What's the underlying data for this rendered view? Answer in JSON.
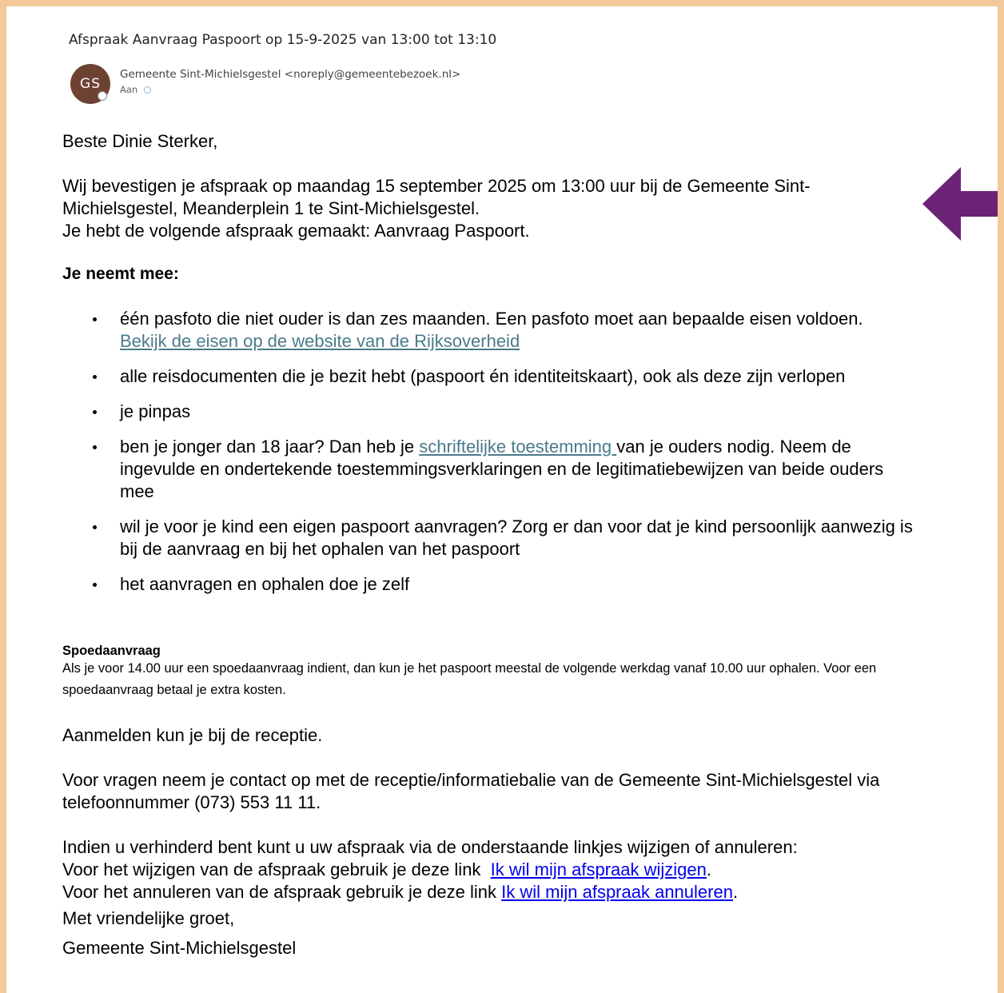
{
  "email": {
    "subject": "Afspraak Aanvraag Paspoort op 15-9-2025 van 13:00 tot 13:10",
    "sender_initials": "GS",
    "sender": "Gemeente Sint-Michielsgestel <noreply@gemeentebezoek.nl>",
    "to_label": "Aan",
    "colors": {
      "avatar": "#6e4232",
      "frame": "#f3c89a",
      "arrow": "#6b2376",
      "link_teal": "#4a7a8c",
      "link_blue": "#0000ee"
    }
  },
  "body": {
    "greeting": "Beste Dinie Sterker,",
    "confirm_line1": "Wij bevestigen je afspraak op maandag 15 september 2025 om 13:00 uur bij de Gemeente Sint-Michielsgestel, Meanderplein 1 te Sint-Michielsgestel.",
    "confirm_line2": "Je hebt de volgende afspraak gemaakt: Aanvraag Paspoort.",
    "bring_heading": "Je neemt mee:",
    "items": [
      {
        "text": "één pasfoto die niet ouder is dan zes maanden. Een pasfoto moet aan bepaalde eisen voldoen. ",
        "link": "Bekijk de eisen op de website van de Rijksoverheid"
      },
      {
        "text": "alle reisdocumenten die je bezit hebt (paspoort én identiteitskaart), ook als deze zijn verlopen"
      },
      {
        "text": "je pinpas"
      },
      {
        "text_before": "ben je jonger dan 18 jaar? Dan heb je ",
        "link": "schriftelijke toestemming ",
        "text_after": "van je ouders nodig.  Neem de ingevulde en ondertekende toestemmingsverklaringen en de legitimatiebewijzen van beide ouders mee"
      },
      {
        "text": "wil je voor je kind een eigen paspoort aanvragen? Zorg er dan voor dat je kind persoonlijk aanwezig is bij de aanvraag en bij het ophalen van het paspoort"
      },
      {
        "text": "het aanvragen en ophalen doe je zelf"
      }
    ],
    "spoed_title": "Spoedaanvraag",
    "spoed_text": "Als je voor 14.00 uur een spoedaanvraag indient, dan kun je het paspoort meestal de volgende werkdag vanaf 10.00 uur ophalen. Voor een spoedaanvraag betaal je extra kosten.",
    "checkin": "Aanmelden kun je bij de receptie.",
    "contact": "Voor vragen neem je contact op met de receptie/informatiebalie van de Gemeente Sint-Michielsgestel via telefoonnummer (073) 553 11 11.",
    "change_intro": "Indien u verhinderd bent kunt u uw afspraak via de onderstaande linkjes wijzigen of annuleren:",
    "change_text": "Voor het wijzigen van de afspraak gebruik je deze link  ",
    "change_link": "Ik wil mijn afspraak wijzigen",
    "cancel_text": "Voor het annuleren van de afspraak gebruik je deze link ",
    "cancel_link": "Ik wil mijn afspraak annuleren",
    "period": ".",
    "closing": "Met vriendelijke groet,",
    "signature": "Gemeente Sint-Michielsgestel"
  }
}
